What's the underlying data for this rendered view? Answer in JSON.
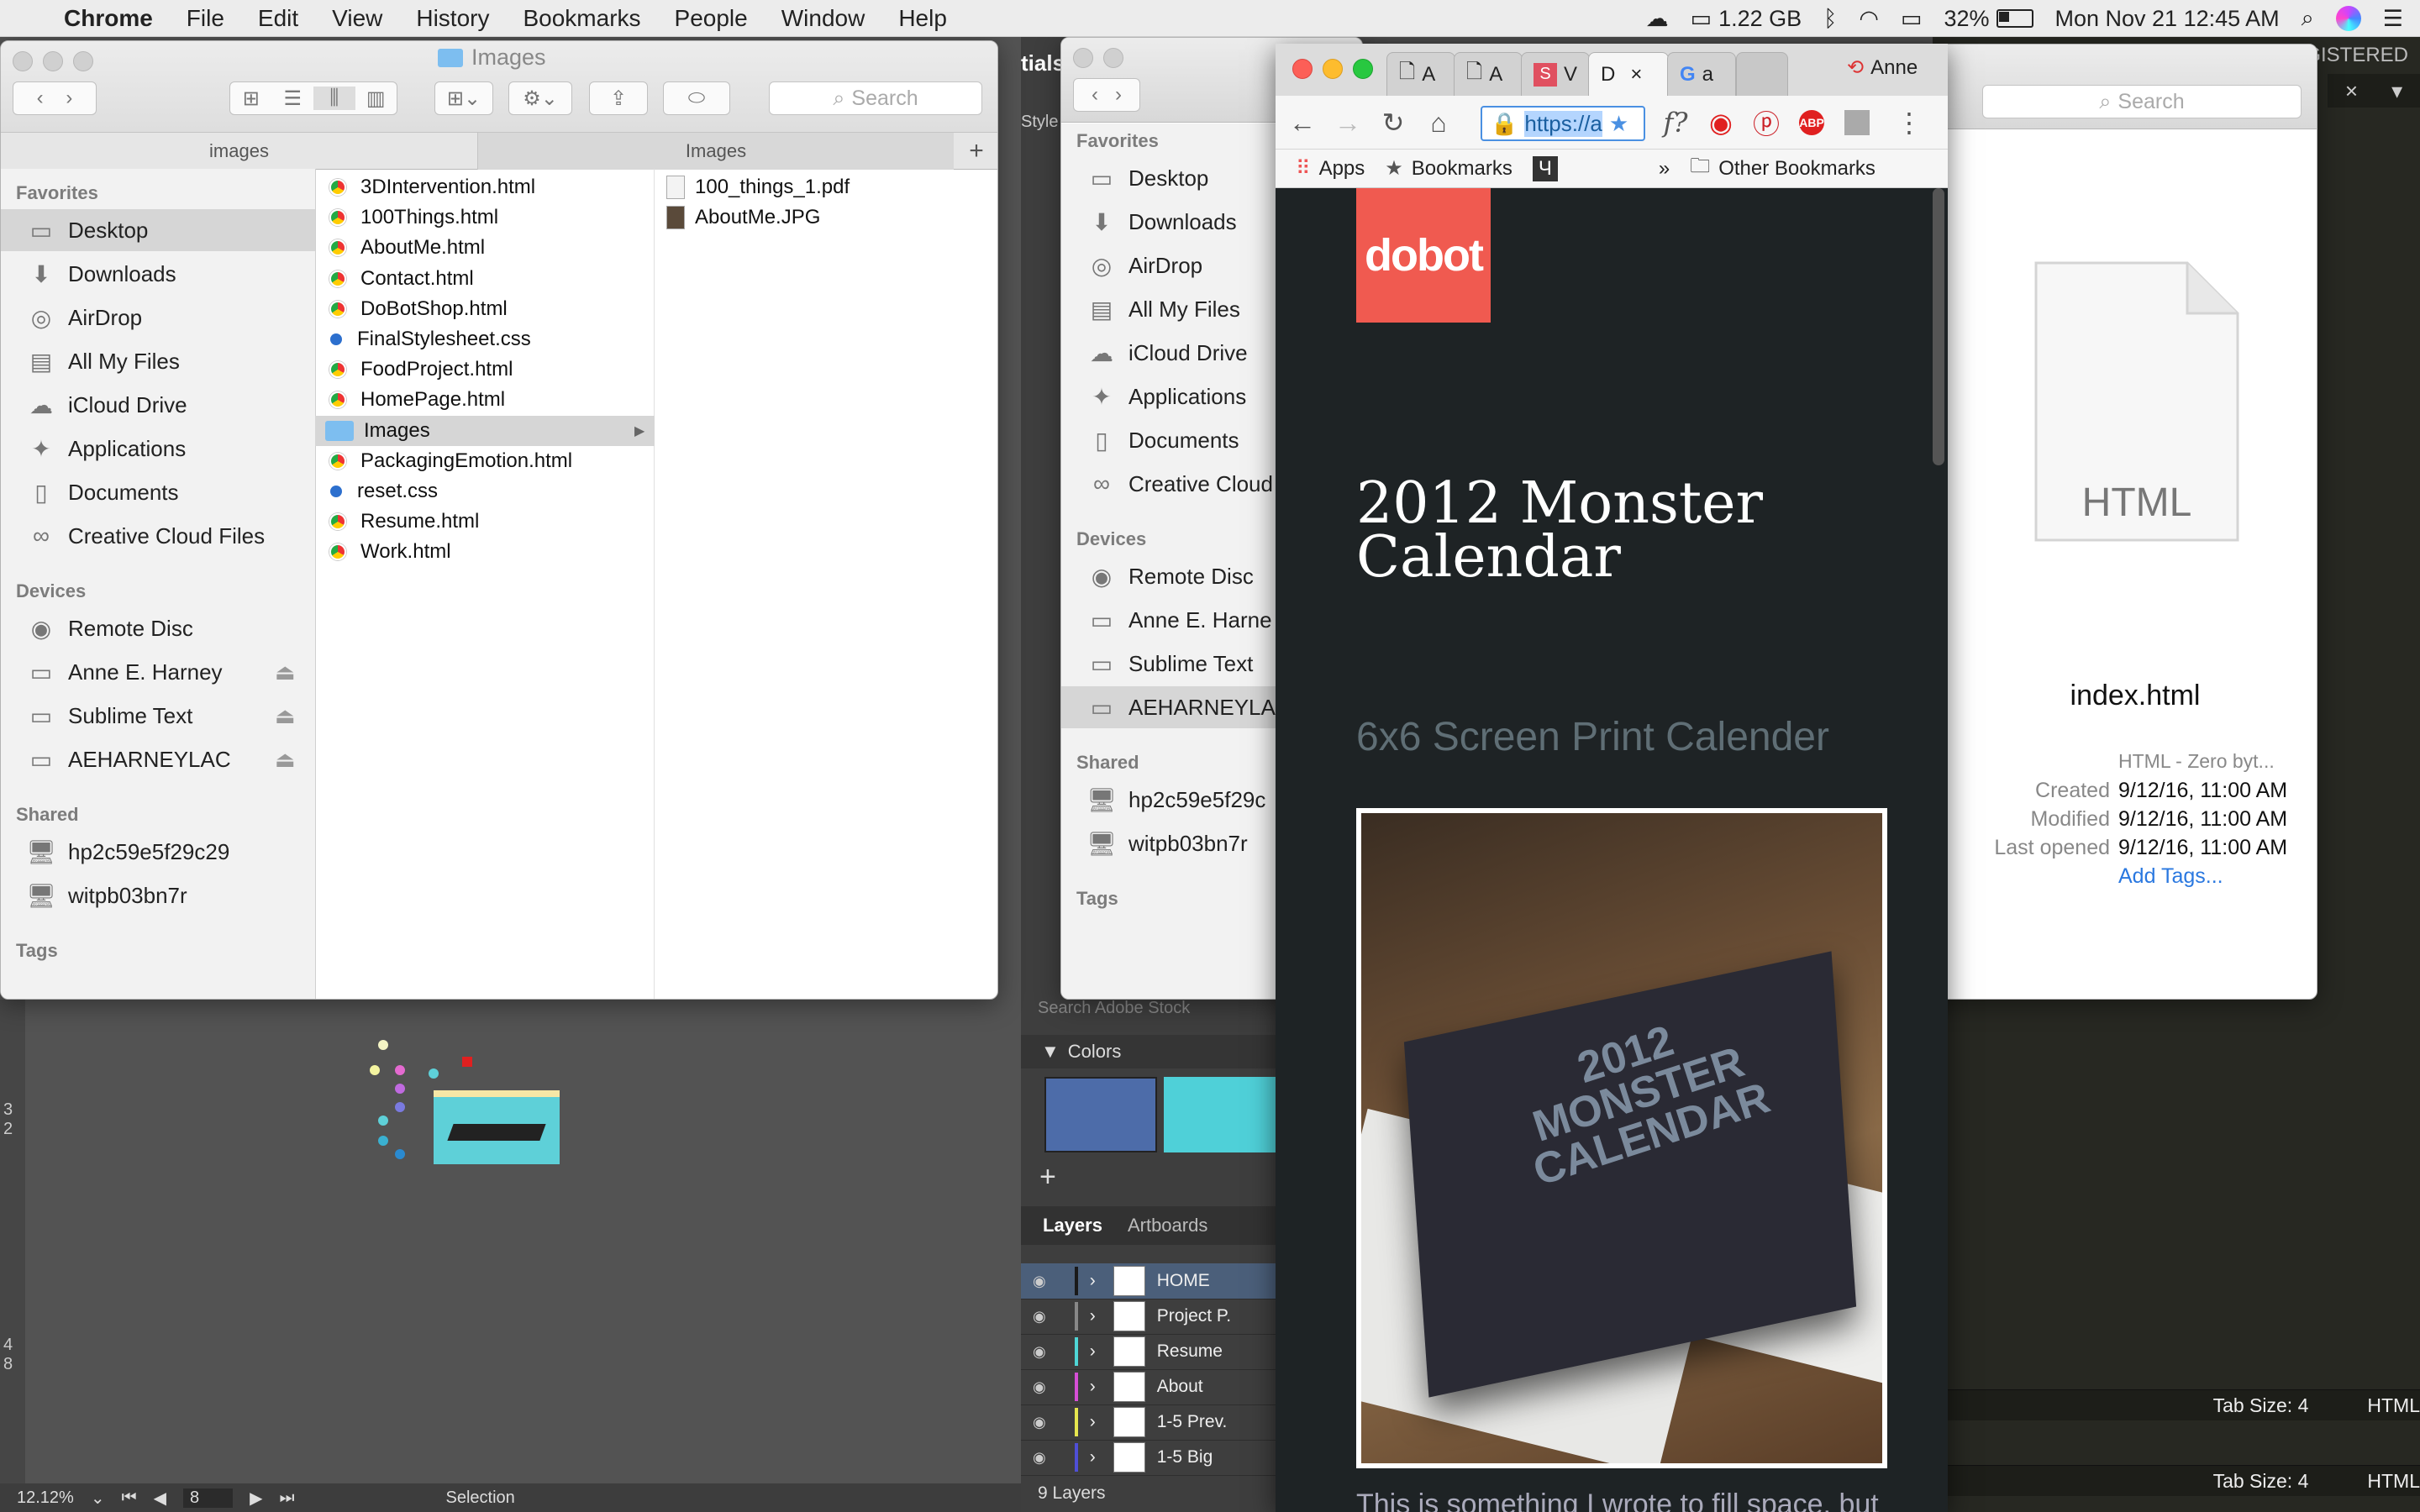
{
  "menubar": {
    "app": "Chrome",
    "items": [
      "File",
      "Edit",
      "View",
      "History",
      "Bookmarks",
      "People",
      "Window",
      "Help"
    ],
    "memory": "1.22 GB",
    "battery": "32%",
    "datetime": "Mon Nov 21  12:45 AM"
  },
  "finder1": {
    "title": "Images",
    "search_placeholder": "Search",
    "col_headers": [
      "images",
      "Images"
    ],
    "favorites_head": "Favorites",
    "favorites": [
      "Desktop",
      "Downloads",
      "AirDrop",
      "All My Files",
      "iCloud Drive",
      "Applications",
      "Documents",
      "Creative Cloud Files"
    ],
    "devices_head": "Devices",
    "devices": [
      "Remote Disc",
      "Anne E. Harney",
      "Sublime Text",
      "AEHARNEYLAC"
    ],
    "shared_head": "Shared",
    "shared": [
      "hp2c59e5f29c29",
      "witpb03bn7r"
    ],
    "tags_head": "Tags",
    "files": [
      "3DIntervention.html",
      "100Things.html",
      "AboutMe.html",
      "Contact.html",
      "DoBotShop.html",
      "FinalStylesheet.css",
      "FoodProject.html",
      "HomePage.html",
      "Images",
      "PackagingEmotion.html",
      "reset.css",
      "Resume.html",
      "Work.html"
    ],
    "images_files": [
      "100_things_1.pdf",
      "AboutMe.JPG"
    ]
  },
  "finder2": {
    "favorites_head": "Favorites",
    "favorites": [
      "Desktop",
      "Downloads",
      "AirDrop",
      "All My Files",
      "iCloud Drive",
      "Applications",
      "Documents",
      "Creative Cloud"
    ],
    "devices_head": "Devices",
    "devices": [
      "Remote Disc",
      "Anne E. Harne",
      "Sublime Text",
      "AEHARNEYLAC"
    ],
    "shared_head": "Shared",
    "shared": [
      "hp2c59e5f29c",
      "witpb03bn7r"
    ],
    "tags_head": "Tags"
  },
  "finder3": {
    "search_placeholder": "Search",
    "file_type_badge": "HTML",
    "filename": "index.html",
    "kind": "HTML - Zero byt...",
    "created_label": "Created",
    "created": "9/12/16, 11:00 AM",
    "modified_label": "Modified",
    "modified": "9/12/16, 11:00 AM",
    "opened_label": "Last opened",
    "opened": "9/12/16, 11:00 AM",
    "add_tags": "Add Tags..."
  },
  "chrome": {
    "tabs": [
      "A",
      "A",
      "V",
      "D",
      "a"
    ],
    "profile": "Anne",
    "url": "https://a",
    "bookmarks": [
      "Apps",
      "Bookmarks",
      "Other Bookmarks"
    ],
    "page": {
      "logo": "dobot",
      "title_line1": "2012 Monster",
      "title_line2": "Calendar",
      "subtitle": "6x6 Screen Print Calender",
      "photo_text_a": "2012",
      "photo_text_b": "MONSTER",
      "photo_text_c": "CALENDAR",
      "body": "This is something I wrote to fill space, but"
    }
  },
  "illustrator": {
    "partial_top_label": "tials",
    "style_label": "Style",
    "colors_label": "Colors",
    "layers_tab": "Layers",
    "artboards_tab": "Artboards",
    "layers": [
      {
        "name": "HOME",
        "color": "#1a1a1a"
      },
      {
        "name": "Project P.",
        "color": "#888888"
      },
      {
        "name": "Resume",
        "color": "#4fd6d6"
      },
      {
        "name": "About",
        "color": "#d64fd6"
      },
      {
        "name": "1-5 Prev.",
        "color": "#e6e64f"
      },
      {
        "name": "1-5 Big",
        "color": "#4f4fd6"
      }
    ],
    "layers_count": "9 Layers",
    "search_stock": "Search Adobe Stock",
    "zoom": "12.12%",
    "artboard": "8",
    "tool": "Selection",
    "ruler_3": "3 2",
    "ruler_4": "4 8"
  },
  "sublime": {
    "registered": "GISTERED",
    "tab_size_1": "Tab Size: 4",
    "syntax_1": "HTML",
    "tab_size_2": "Tab Size: 4",
    "syntax_2": "HTML"
  }
}
